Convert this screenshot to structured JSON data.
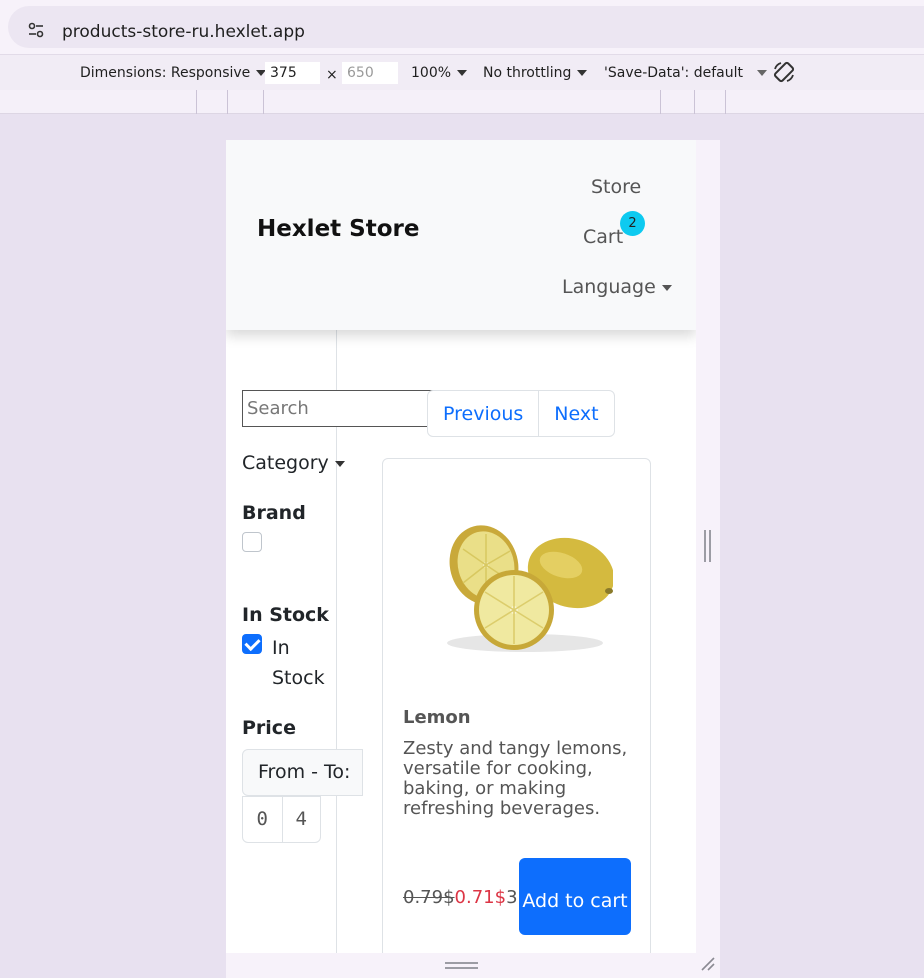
{
  "browser": {
    "url": "products-store-ru.hexlet.app"
  },
  "devtools": {
    "dimensions_label": "Dimensions: Responsive",
    "width": "375",
    "times": "×",
    "height": "650",
    "zoom": "100%",
    "throttling": "No throttling",
    "save_data": "'Save-Data': default"
  },
  "site": {
    "brand": "Hexlet Store",
    "nav": {
      "store": "Store",
      "cart": "Cart",
      "cart_count": "2",
      "language": "Language"
    },
    "search_placeholder": "Search",
    "pagination": {
      "previous": "Previous",
      "next": "Next"
    },
    "filters": {
      "category": "Category",
      "brand": "Brand",
      "in_stock_heading": "In Stock",
      "in_stock_option": "In Stock",
      "in_stock_checked": true,
      "price_heading": "Price",
      "price_range_label": "From - To:",
      "price_from": "0",
      "price_to": "4"
    },
    "product": {
      "name": "Lemon",
      "description": "Zesty and tangy lemons, versatile for cooking, baking, or making refreshing beverages.",
      "old_price": "0.79$",
      "new_price": "0.71$",
      "stock": "31",
      "add_to_cart": "Add to cart"
    }
  },
  "colors": {
    "primary": "#0d6efd",
    "badge": "#0dcaf0",
    "sale_price": "#dc3545"
  }
}
